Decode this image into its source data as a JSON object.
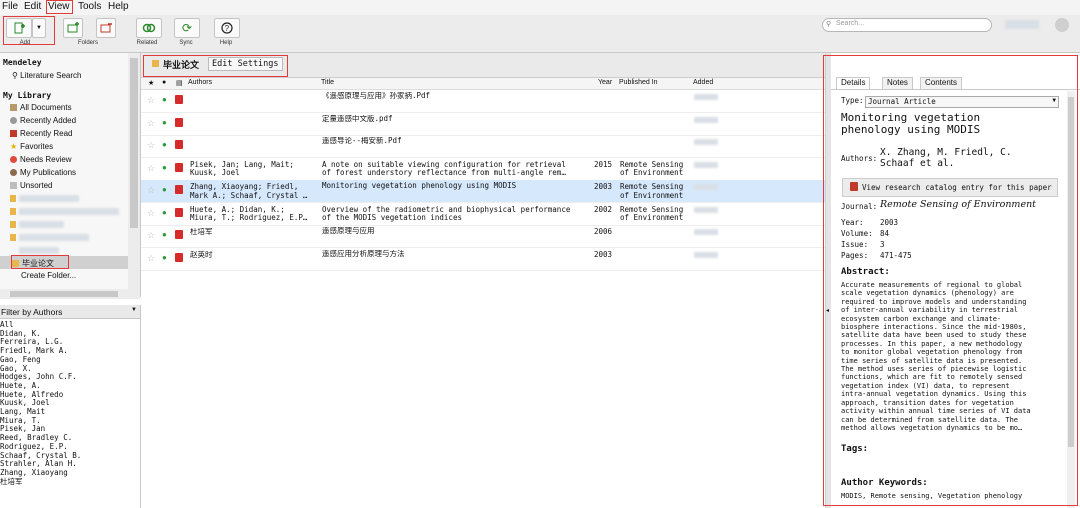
{
  "menu": {
    "items": [
      "File",
      "Edit",
      "View",
      "Tools",
      "Help"
    ]
  },
  "toolbar": {
    "add": "Add",
    "folders": "Folders",
    "related": "Related",
    "sync": "Sync",
    "help": "Help"
  },
  "search": {
    "placeholder": "Search..."
  },
  "sidebar": {
    "section_title": "Mendeley",
    "literature_search": "Literature Search",
    "my_library": "My Library",
    "items": [
      "All Documents",
      "Recently Added",
      "Recently Read",
      "Favorites",
      "Needs Review",
      "My Publications",
      "Unsorted"
    ],
    "selected_folder": "毕业论文",
    "create_folder": "Create Folder..."
  },
  "filter": {
    "title": "Filter by Authors",
    "authors": [
      "All",
      "Didan, K.",
      "Ferreira, L.G.",
      "Friedl, Mark A.",
      "Gao, Feng",
      "Gao, X.",
      "Hodges, John C.F.",
      "Huete, A.",
      "Huete, Alfredo",
      "Kuusk, Joel",
      "Lang, Mait",
      "Miura, T.",
      "Pisek, Jan",
      "Reed, Bradley C.",
      "Rodriguez, E.P.",
      "Schaaf, Crystal B.",
      "Strahler, Alan H.",
      "Zhang, Xiaoyang",
      "杜培军"
    ]
  },
  "center": {
    "tab_label": "毕业论文",
    "edit_settings": "Edit Settings",
    "columns": {
      "authors": "Authors",
      "title": "Title",
      "year": "Year",
      "published_in": "Published In",
      "added": "Added"
    },
    "rows": [
      {
        "authors": "",
        "title": "《遥感原理与应用》孙家抦.Pdf",
        "year": "",
        "pub": ""
      },
      {
        "authors": "",
        "title": "定量遥感中文版.pdf",
        "year": "",
        "pub": ""
      },
      {
        "authors": "",
        "title": "遥感导论--梅安新.Pdf",
        "year": "",
        "pub": ""
      },
      {
        "authors": "Pisek, Jan; Lang, Mait;\nKuusk, Joel",
        "title": "A note on suitable viewing configuration for retrieval\nof forest understory reflectance from multi-angle rem…",
        "year": "2015",
        "pub": "Remote Sensing\nof Environment"
      },
      {
        "authors": "Zhang, Xiaoyang; Friedl,\nMark A.; Schaaf, Crystal …",
        "title": "Monitoring vegetation phenology using MODIS",
        "year": "2003",
        "pub": "Remote Sensing\nof Environment"
      },
      {
        "authors": "Huete, A.; Didan, K.;\nMiura, T.; Rodriguez, E.P…",
        "title": "Overview of the radiometric and biophysical performance\nof the MODIS vegetation indices",
        "year": "2002",
        "pub": "Remote Sensing\nof Environment"
      },
      {
        "authors": "杜培军",
        "title": "遥感原理与应用",
        "year": "2006",
        "pub": ""
      },
      {
        "authors": "赵英时",
        "title": "遥感应用分析原理与方法",
        "year": "2003",
        "pub": ""
      }
    ]
  },
  "details": {
    "tabs": [
      "Details",
      "Notes",
      "Contents"
    ],
    "type_label": "Type:",
    "type_value": "Journal Article",
    "title": "Monitoring vegetation\nphenology using MODIS",
    "authors_label": "Authors:",
    "authors_value": "X. Zhang, M. Friedl, C.\nSchaaf et al.",
    "catalog_button": "View research catalog entry for this paper",
    "journal_label": "Journal:",
    "journal_value": "Remote Sensing of Environment",
    "year_label": "Year:",
    "year_value": "2003",
    "volume_label": "Volume:",
    "volume_value": "84",
    "issue_label": "Issue:",
    "issue_value": "3",
    "pages_label": "Pages:",
    "pages_value": "471-475",
    "abstract_label": "Abstract:",
    "abstract_text": "Accurate measurements of regional to global\nscale vegetation dynamics (phenology) are\nrequired to improve models and understanding\nof inter-annual variability in terrestrial\necosystem carbon exchange and climate-\nbiosphere interactions. Since the mid-1980s,\nsatellite data have been used to study these\nprocesses. In this paper, a new methodology\nto monitor global vegetation phenology from\ntime series of satellite data is presented.\nThe method uses series of piecewise logistic\nfunctions, which are fit to remotely sensed\nvegetation index (VI) data, to represent\nintra-annual vegetation dynamics. Using this\napproach, transition dates for vegetation\nactivity within annual time series of VI data\ncan be determined from satellite data. The\nmethod allows vegetation dynamics to be mo…",
    "tags_label": "Tags:",
    "keywords_label": "Author Keywords:",
    "keywords_value": "MODIS, Remote sensing, Vegetation phenology"
  }
}
